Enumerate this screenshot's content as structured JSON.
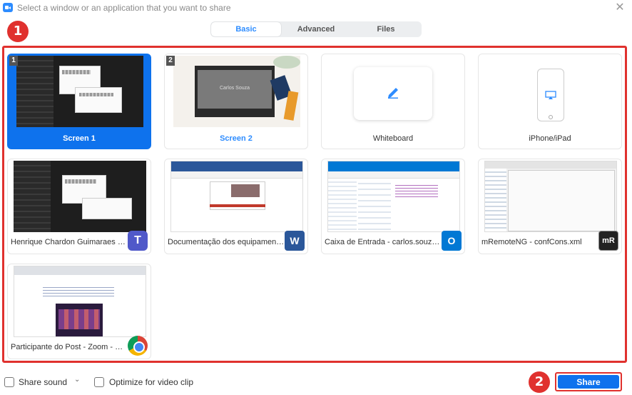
{
  "window": {
    "title": "Select a window or an application that you want to share",
    "close_glyph": "✕"
  },
  "tabs": [
    {
      "label": "Basic",
      "active": true
    },
    {
      "label": "Advanced",
      "active": false
    },
    {
      "label": "Files",
      "active": false
    }
  ],
  "annotations": {
    "badge1": "1",
    "badge2": "2"
  },
  "cards": [
    {
      "label": "Screen 1",
      "number": "1",
      "selected": true
    },
    {
      "label": "Screen 2",
      "number": "2",
      "thumb_text": "Carlos Souza"
    },
    {
      "label": "Whiteboard",
      "icon": "pencil-icon"
    },
    {
      "label": "iPhone/iPad",
      "icon": "airplay-icon"
    },
    {
      "label": "Henrique Chardon Guimaraes C...",
      "app_icon": "teams-icon"
    },
    {
      "label": "Documentação dos equipament...",
      "app_icon": "word-icon"
    },
    {
      "label": "Caixa de Entrada - carlos.souza@...",
      "app_icon": "outlook-icon"
    },
    {
      "label": "mRemoteNG - confCons.xml",
      "app_icon": "mremoteng-icon"
    },
    {
      "label": "Participante do Post - Zoom - Go...",
      "app_icon": "chrome-icon"
    }
  ],
  "bottom": {
    "share_sound_label": "Share sound",
    "optimize_label": "Optimize for video clip",
    "share_button": "Share",
    "caret": "⌄"
  },
  "colors": {
    "accent": "#0e72ed",
    "highlight": "#e0312e"
  }
}
